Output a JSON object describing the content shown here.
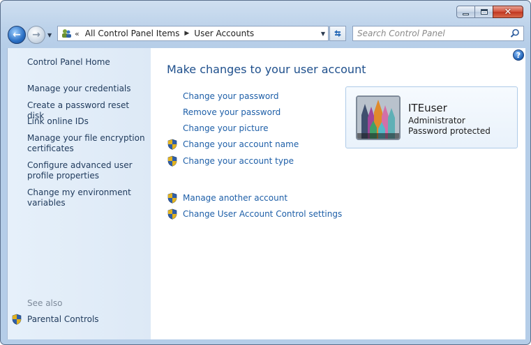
{
  "window": {
    "caption_buttons": {
      "minimize": "minimize-icon",
      "maximize": "maximize-icon",
      "close": "close-icon"
    }
  },
  "nav": {
    "breadcrumb": [
      "All Control Panel Items",
      "User Accounts"
    ],
    "breadcrumb_overflow": "«",
    "search_placeholder": "Search Control Panel"
  },
  "sidebar": {
    "home": "Control Panel Home",
    "links": [
      "Manage your credentials",
      "Create a password reset disk",
      "Link online IDs",
      "Manage your file encryption certificates",
      "Configure advanced user profile properties",
      "Change my environment variables"
    ],
    "see_also_label": "See also",
    "see_also_links": [
      "Parental Controls"
    ]
  },
  "main": {
    "title": "Make changes to your user account",
    "tasks": [
      {
        "label": "Change your password",
        "shield": false
      },
      {
        "label": "Remove your password",
        "shield": false
      },
      {
        "label": "Change your picture",
        "shield": false
      },
      {
        "label": "Change your account name",
        "shield": true
      },
      {
        "label": "Change your account type",
        "shield": true
      }
    ],
    "other_tasks": [
      {
        "label": "Manage another account",
        "shield": true
      },
      {
        "label": "Change User Account Control settings",
        "shield": true
      }
    ]
  },
  "user": {
    "name": "ITEuser",
    "role": "Administrator",
    "status": "Password protected"
  },
  "colors": {
    "link": "#1e5fa8",
    "title": "#1e4f8c",
    "sidebar_link": "#1e395b",
    "chrome": "#bcd2ea"
  }
}
